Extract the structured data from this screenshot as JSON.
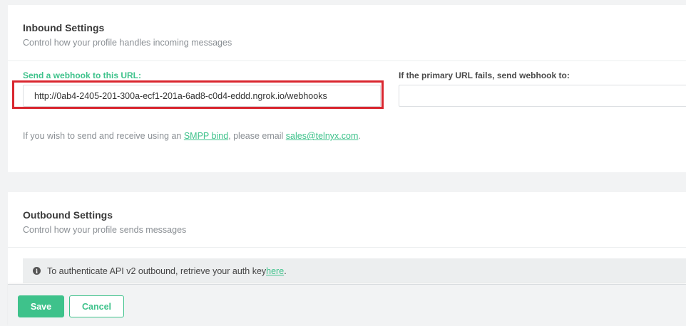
{
  "inbound": {
    "title": "Inbound Settings",
    "subtitle": "Control how your profile handles incoming messages",
    "primary_label": "Send a webhook to this URL:",
    "primary_value": "http://0ab4-2405-201-300a-ecf1-201a-6ad8-c0d4-eddd.ngrok.io/webhooks",
    "fallback_label": "If the primary URL fails, send webhook to:",
    "fallback_value": "",
    "info_prefix": "If you wish to send and receive using an ",
    "smpp_link": "SMPP bind",
    "info_middle": ", please email ",
    "email_link": "sales@telnyx.com",
    "info_suffix": "."
  },
  "outbound": {
    "title": "Outbound Settings",
    "subtitle": "Control how your profile sends messages",
    "notice_text": "To authenticate API v2 outbound, retrieve your auth key ",
    "notice_link": "here",
    "notice_suffix": "."
  },
  "footer": {
    "save_label": "Save",
    "cancel_label": "Cancel"
  },
  "colors": {
    "accent": "#3ec28b",
    "highlight": "#d9262f",
    "background": "#f2f3f4"
  },
  "icons": {
    "notice": "info-circle-icon"
  }
}
